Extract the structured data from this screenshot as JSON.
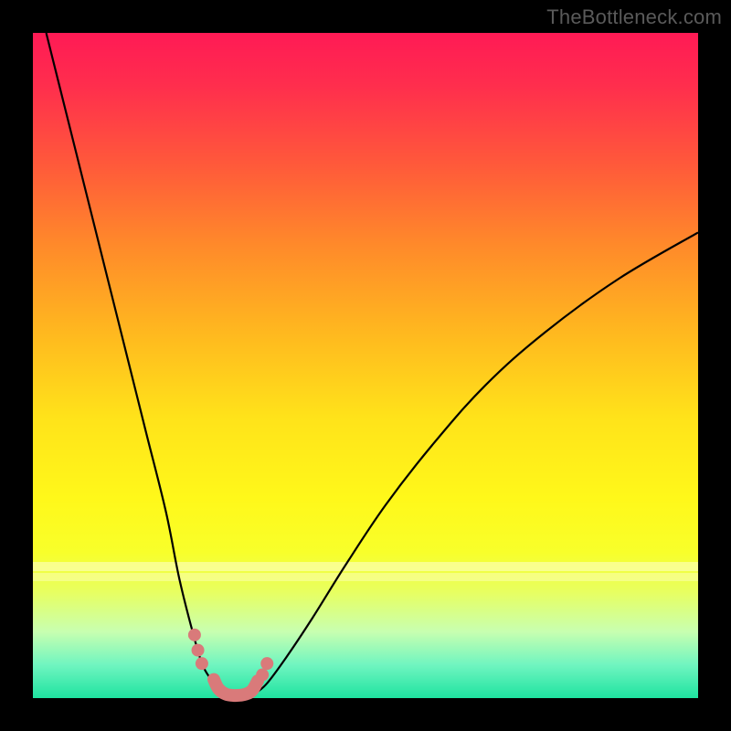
{
  "watermark": "TheBottleneck.com",
  "chart_data": {
    "type": "line",
    "title": "",
    "xlabel": "",
    "ylabel": "",
    "xlim": [
      0,
      100
    ],
    "ylim": [
      0,
      100
    ],
    "left_curve": {
      "name": "left-branch",
      "x": [
        2,
        5,
        8,
        11,
        14,
        17,
        20,
        22,
        24,
        25.5,
        27,
        28,
        29
      ],
      "y": [
        100,
        88,
        76,
        64,
        52,
        40,
        28,
        18,
        10,
        5,
        2.5,
        1,
        0.5
      ]
    },
    "right_curve": {
      "name": "right-branch",
      "x": [
        33,
        35,
        38,
        42,
        47,
        53,
        60,
        68,
        77,
        88,
        100
      ],
      "y": [
        0.5,
        2,
        6,
        12,
        20,
        29,
        38,
        47,
        55,
        63,
        70
      ]
    },
    "bottom_segment": {
      "name": "valley-floor",
      "x": [
        29,
        30,
        31,
        32,
        33
      ],
      "y": [
        0.5,
        0.2,
        0.2,
        0.2,
        0.5
      ]
    },
    "markers_left": {
      "name": "left-dots",
      "x": [
        24.3,
        24.8,
        25.4
      ],
      "y": [
        9.5,
        7.2,
        5.2
      ]
    },
    "markers_right": {
      "name": "right-dots",
      "x": [
        34.5,
        35.2
      ],
      "y": [
        3.5,
        5.2
      ]
    },
    "worm": {
      "name": "bottom-worm",
      "x": [
        27.2,
        27.9,
        29.0,
        30.5,
        32.0,
        33.0,
        33.8
      ],
      "y": [
        2.8,
        1.4,
        0.6,
        0.4,
        0.6,
        1.2,
        2.6
      ]
    },
    "colors": {
      "curve": "#000000",
      "marker": "#d97a7a",
      "worm": "#d97a7a"
    }
  }
}
